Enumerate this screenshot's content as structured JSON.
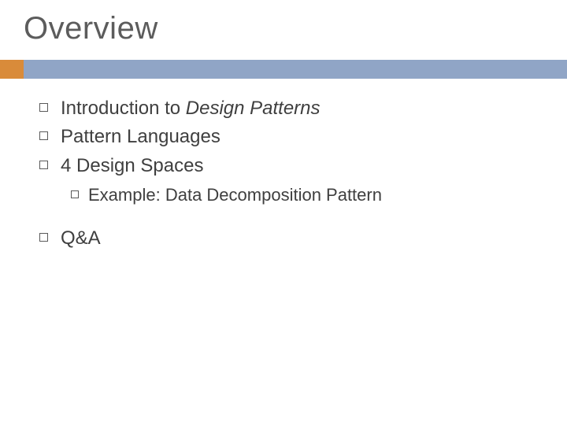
{
  "title": "Overview",
  "bullets": {
    "b1_prefix": "Introduction to ",
    "b1_italic": "Design Patterns",
    "b2": "Pattern Languages",
    "b3": "4 Design Spaces",
    "b3_sub_prefix": "Example:",
    "b3_sub_rest": " Data Decomposition Pattern",
    "b4": "Q&A"
  }
}
